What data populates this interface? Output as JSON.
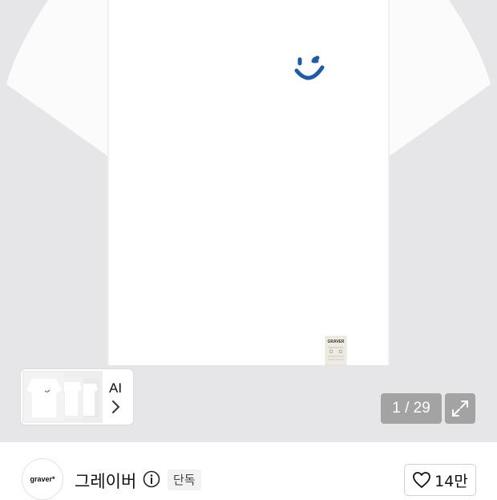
{
  "gallery": {
    "ai_label": "AI",
    "counter": "1 / 29"
  },
  "product": {
    "tag_brand": "GRAVER"
  },
  "brand": {
    "logo_text": "graver*",
    "name": "그레이버",
    "badge": "단독"
  },
  "like": {
    "count": "14만"
  },
  "colors": {
    "smile": "#1f5aa8",
    "background": "#e6e6e8"
  }
}
